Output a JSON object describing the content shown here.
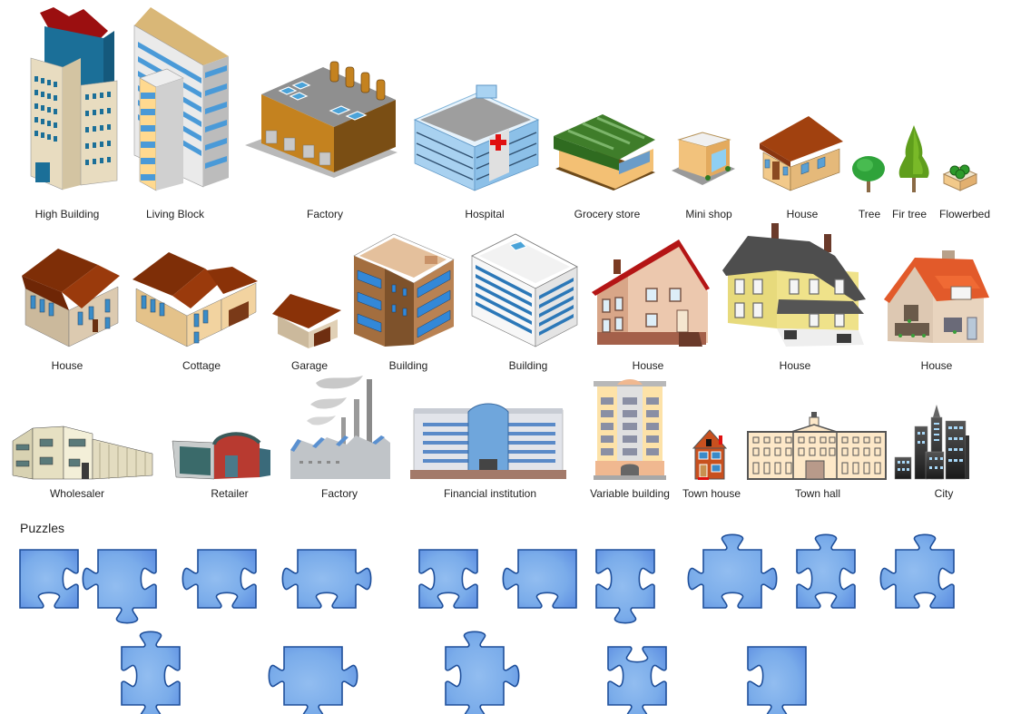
{
  "library": {
    "buildings": [
      {
        "id": "high-building",
        "label": "High Building",
        "icon": "high-building-icon"
      },
      {
        "id": "living-block",
        "label": "Living Block",
        "icon": "living-block-icon"
      },
      {
        "id": "factory-iso",
        "label": "Factory",
        "icon": "factory-icon"
      },
      {
        "id": "hospital",
        "label": "Hospital",
        "icon": "hospital-icon"
      },
      {
        "id": "grocery-store",
        "label": "Grocery store",
        "icon": "grocery-store-icon"
      },
      {
        "id": "mini-shop",
        "label": "Mini shop",
        "icon": "mini-shop-icon"
      },
      {
        "id": "house-iso",
        "label": "House",
        "icon": "house-icon"
      },
      {
        "id": "tree",
        "label": "Tree",
        "icon": "tree-icon"
      },
      {
        "id": "fir-tree",
        "label": "Fir tree",
        "icon": "fir-tree-icon"
      },
      {
        "id": "flowerbed",
        "label": "Flowerbed",
        "icon": "flowerbed-icon"
      },
      {
        "id": "house-2",
        "label": "House",
        "icon": "house-icon"
      },
      {
        "id": "cottage",
        "label": "Cottage",
        "icon": "cottage-icon"
      },
      {
        "id": "garage",
        "label": "Garage",
        "icon": "garage-icon"
      },
      {
        "id": "building-brown",
        "label": "Building",
        "icon": "building-icon"
      },
      {
        "id": "building-white",
        "label": "Building",
        "icon": "building-icon"
      },
      {
        "id": "house-3",
        "label": "House",
        "icon": "house-icon"
      },
      {
        "id": "house-4",
        "label": "House",
        "icon": "house-icon"
      },
      {
        "id": "house-5",
        "label": "House",
        "icon": "house-icon"
      },
      {
        "id": "wholesaler",
        "label": "Wholesaler",
        "icon": "wholesaler-icon"
      },
      {
        "id": "retailer",
        "label": "Retailer",
        "icon": "retailer-icon"
      },
      {
        "id": "factory-smoke",
        "label": "Factory",
        "icon": "factory-icon"
      },
      {
        "id": "financial-institution",
        "label": "Financial institution",
        "icon": "bank-icon"
      },
      {
        "id": "variable-building",
        "label": "Variable building",
        "icon": "building-icon"
      },
      {
        "id": "town-house",
        "label": "Town house",
        "icon": "town-house-icon"
      },
      {
        "id": "town-hall",
        "label": "Town hall",
        "icon": "town-hall-icon"
      },
      {
        "id": "city",
        "label": "City",
        "icon": "city-icon"
      }
    ],
    "puzzles_title": "Puzzles",
    "puzzle_count": 15,
    "colors": {
      "puzzle_fill_light": "#8db8ee",
      "puzzle_fill_dark": "#6f9fe6",
      "puzzle_stroke": "#1f4f9a",
      "label_text": "#222222"
    }
  }
}
